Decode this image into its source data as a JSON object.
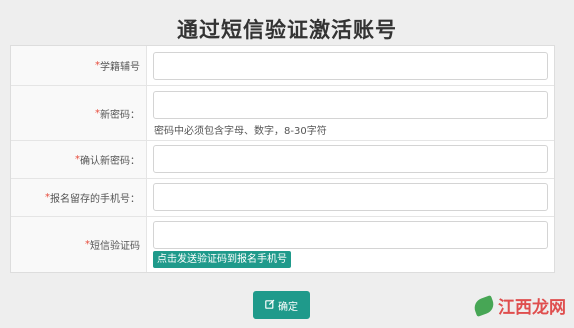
{
  "page": {
    "title": "通过短信验证激活账号"
  },
  "form": {
    "fields": [
      {
        "required_mark": "*",
        "label": "学籍辅号",
        "value": "",
        "placeholder": ""
      },
      {
        "required_mark": "*",
        "label": "新密码：",
        "value": "",
        "placeholder": "",
        "hint": "密码中必须包含字母、数字，8-30字符"
      },
      {
        "required_mark": "*",
        "label": "确认新密码：",
        "value": "",
        "placeholder": ""
      },
      {
        "required_mark": "*",
        "label": "报名留存的手机号：",
        "value": "",
        "placeholder": ""
      },
      {
        "required_mark": "*",
        "label": "短信验证码",
        "value": "",
        "placeholder": "",
        "button": "点击发送验证码到报名手机号"
      }
    ],
    "submit_label": "确定",
    "submit_icon": "edit-icon"
  },
  "watermark": {
    "text": "江西龙网"
  },
  "colors": {
    "accent": "#1f9a8b",
    "required": "#e74c3c",
    "background": "#eeeeee"
  }
}
